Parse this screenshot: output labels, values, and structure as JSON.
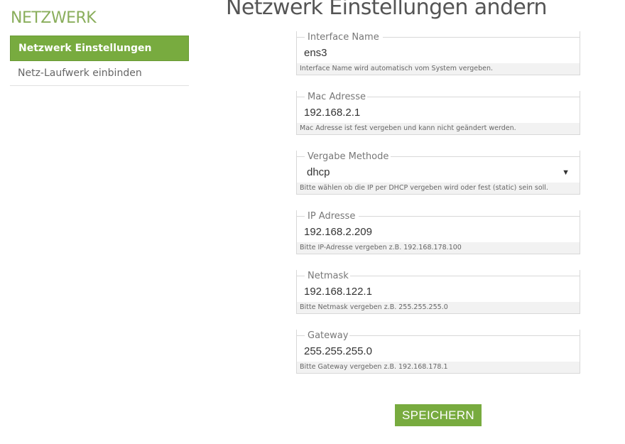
{
  "sidebar": {
    "title": "NETZWERK",
    "items": [
      {
        "label": "Netzwerk Einstellungen",
        "active": true
      },
      {
        "label": "Netz-Laufwerk einbinden",
        "active": false
      }
    ]
  },
  "main": {
    "title": "Netzwerk Einstellungen ändern"
  },
  "form": {
    "interface_name": {
      "label": "Interface Name",
      "value": "ens3",
      "hint": "Interface Name wird automatisch vom System vergeben."
    },
    "mac_address": {
      "label": "Mac Adresse",
      "value": "192.168.2.1",
      "hint": "Mac Adresse ist fest vergeben und kann nicht geändert werden."
    },
    "method": {
      "label": "Vergabe Methode",
      "value": "dhcp",
      "hint": "Bitte wählen ob die IP per DHCP vergeben wird oder fest (static) sein soll."
    },
    "ip_address": {
      "label": "IP Adresse",
      "value": "192.168.2.209",
      "hint": "Bitte IP-Adresse vergeben z.B. 192.168.178.100"
    },
    "netmask": {
      "label": "Netmask",
      "value": "192.168.122.1",
      "hint": "Bitte Netmask vergeben z.B. 255.255.255.0"
    },
    "gateway": {
      "label": "Gateway",
      "value": "255.255.255.0",
      "hint": "Bitte Gateway vergeben z.B. 192.168.178.1"
    },
    "save_label": "SPEICHERN"
  },
  "icons": {
    "select_arrow": "▼"
  },
  "colors": {
    "accent": "#78ab3f",
    "sidebar_title": "#8aae5c"
  }
}
